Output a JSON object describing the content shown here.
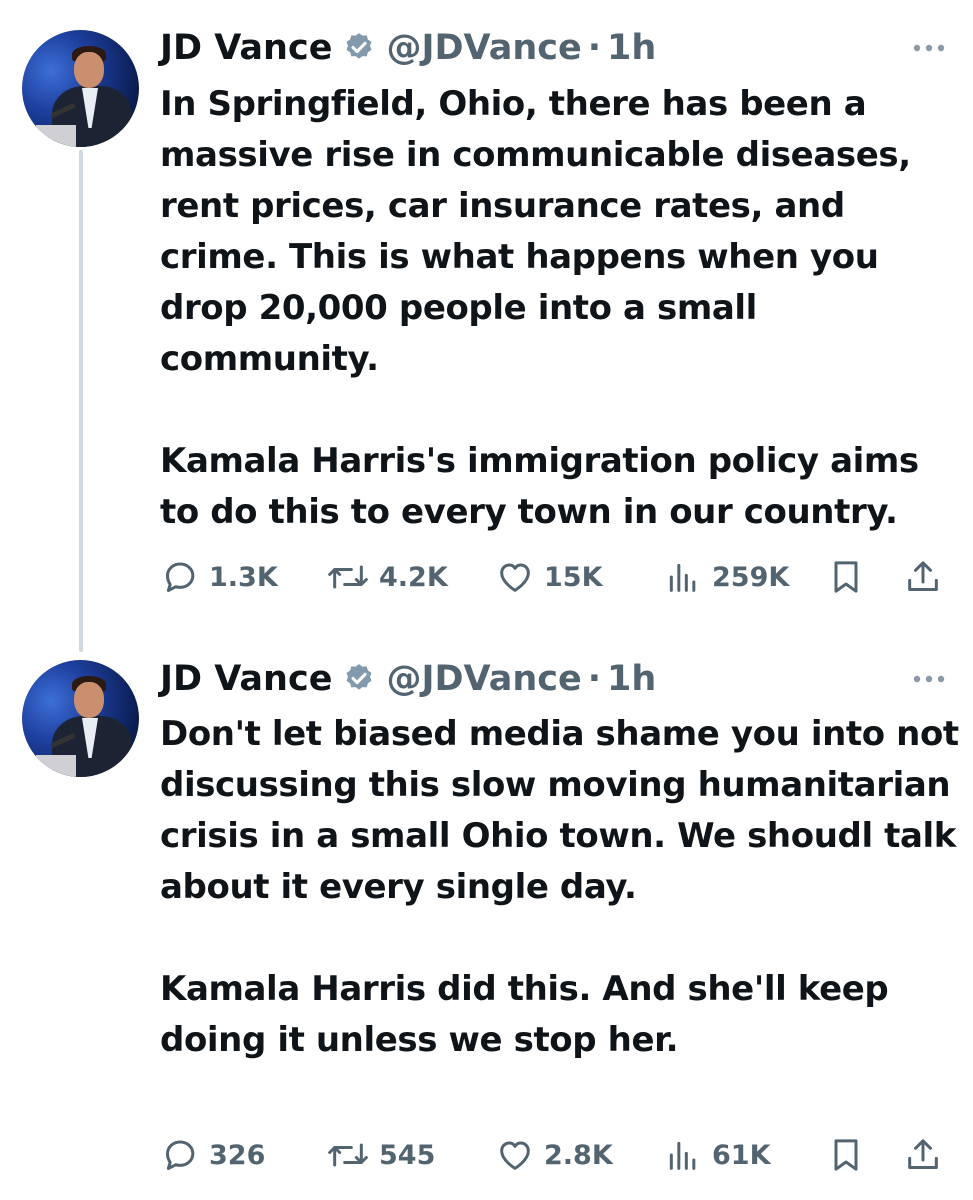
{
  "tweets": [
    {
      "author_name": "JD Vance",
      "handle": "@JDVance",
      "separator": "·",
      "time": "1h",
      "paragraphs": [
        "In Springfield, Ohio, there has been a massive rise in communicable diseases, rent prices, car insurance rates, and crime. This is what happens when you drop 20,000 people into a small community.",
        "Kamala Harris's immigration policy aims to do this to every town in our country."
      ],
      "replies": "1.3K",
      "reposts": "4.2K",
      "likes": "15K",
      "views": "259K"
    },
    {
      "author_name": "JD Vance",
      "handle": "@JDVance",
      "separator": "·",
      "time": "1h",
      "paragraphs": [
        "Don't let biased media shame you into not discussing this slow moving humanitarian crisis in a small Ohio town. We shoudl talk about it every single day.",
        "Kamala Harris did this. And she'll keep doing it unless we stop her."
      ],
      "replies": "326",
      "reposts": "545",
      "likes": "2.8K",
      "views": "61K"
    }
  ],
  "colors": {
    "text": "#0f1419",
    "secondary": "#536471",
    "verified": "#829aab",
    "thread_line": "#cfd9de"
  },
  "icons": [
    "reply-icon",
    "repost-icon",
    "like-icon",
    "views-icon",
    "bookmark-icon",
    "share-icon",
    "verified-badge-icon",
    "more-icon"
  ]
}
